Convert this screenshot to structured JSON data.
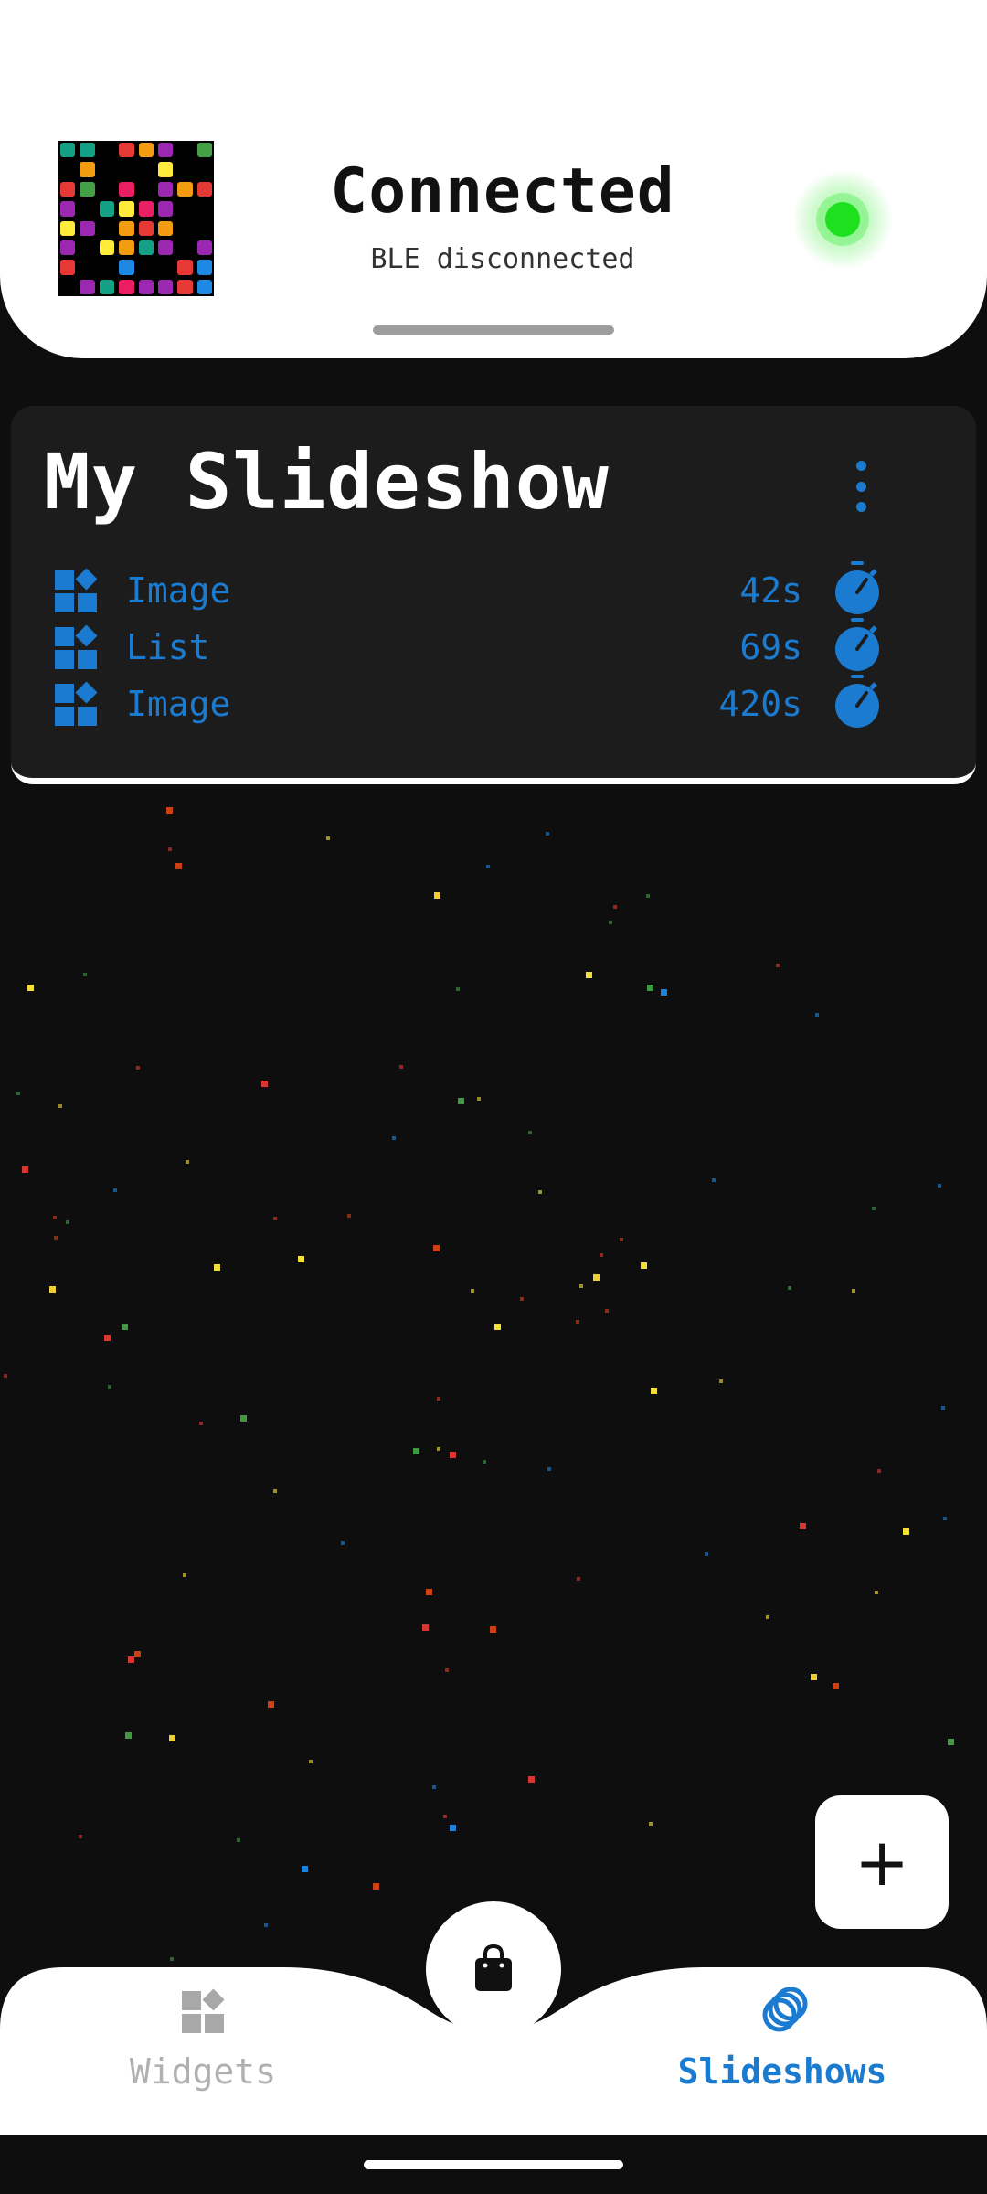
{
  "header": {
    "status_title": "Connected",
    "status_subtitle": "BLE disconnected",
    "status_color": "#1fe01f",
    "logo_colors": [
      "#14a085",
      "#14a085",
      "#000000",
      "#e53935",
      "#f39c12",
      "#9c27b0",
      "#000000",
      "#43a047",
      "#000000",
      "#f39c12",
      "#000000",
      "#000000",
      "#000000",
      "#ffeb3b",
      "#000000",
      "#000000",
      "#e53935",
      "#43a047",
      "#000000",
      "#e91e63",
      "#000000",
      "#9c27b0",
      "#f39c12",
      "#e53935",
      "#9c27b0",
      "#000000",
      "#14a085",
      "#ffeb3b",
      "#e91e63",
      "#9c27b0",
      "#000000",
      "#000000",
      "#ffeb3b",
      "#9c27b0",
      "#000000",
      "#f39c12",
      "#e53935",
      "#f39c12",
      "#000000",
      "#000000",
      "#9c27b0",
      "#000000",
      "#ffeb3b",
      "#f39c12",
      "#14a085",
      "#9c27b0",
      "#000000",
      "#9c27b0",
      "#e53935",
      "#000000",
      "#000000",
      "#1e88e5",
      "#000000",
      "#000000",
      "#e53935",
      "#1e88e5",
      "#000000",
      "#9c27b0",
      "#14a085",
      "#e91e63",
      "#9c27b0",
      "#9c27b0",
      "#e53935",
      "#1e88e5"
    ]
  },
  "slideshow": {
    "title": "My Slideshow",
    "menu_icon": "more-vert-icon",
    "items": [
      {
        "type": "Image",
        "duration": "42s",
        "icon": "widgets-icon",
        "timer_icon": "timer-icon"
      },
      {
        "type": "List",
        "duration": "69s",
        "icon": "widgets-icon",
        "timer_icon": "timer-icon"
      },
      {
        "type": "Image",
        "duration": "420s",
        "icon": "widgets-icon",
        "timer_icon": "timer-icon"
      }
    ]
  },
  "fab": {
    "label": "+",
    "icon": "add-icon"
  },
  "bottom_nav": {
    "widgets_label": "Widgets",
    "slideshows_label": "Slideshows",
    "shop_icon": "shopping-bag-icon",
    "active": "Slideshows"
  },
  "colors": {
    "background": "#0e0e0e",
    "accent": "#1a7bd0",
    "card": "#1c1c1c",
    "inactive": "#b0b0b0"
  }
}
